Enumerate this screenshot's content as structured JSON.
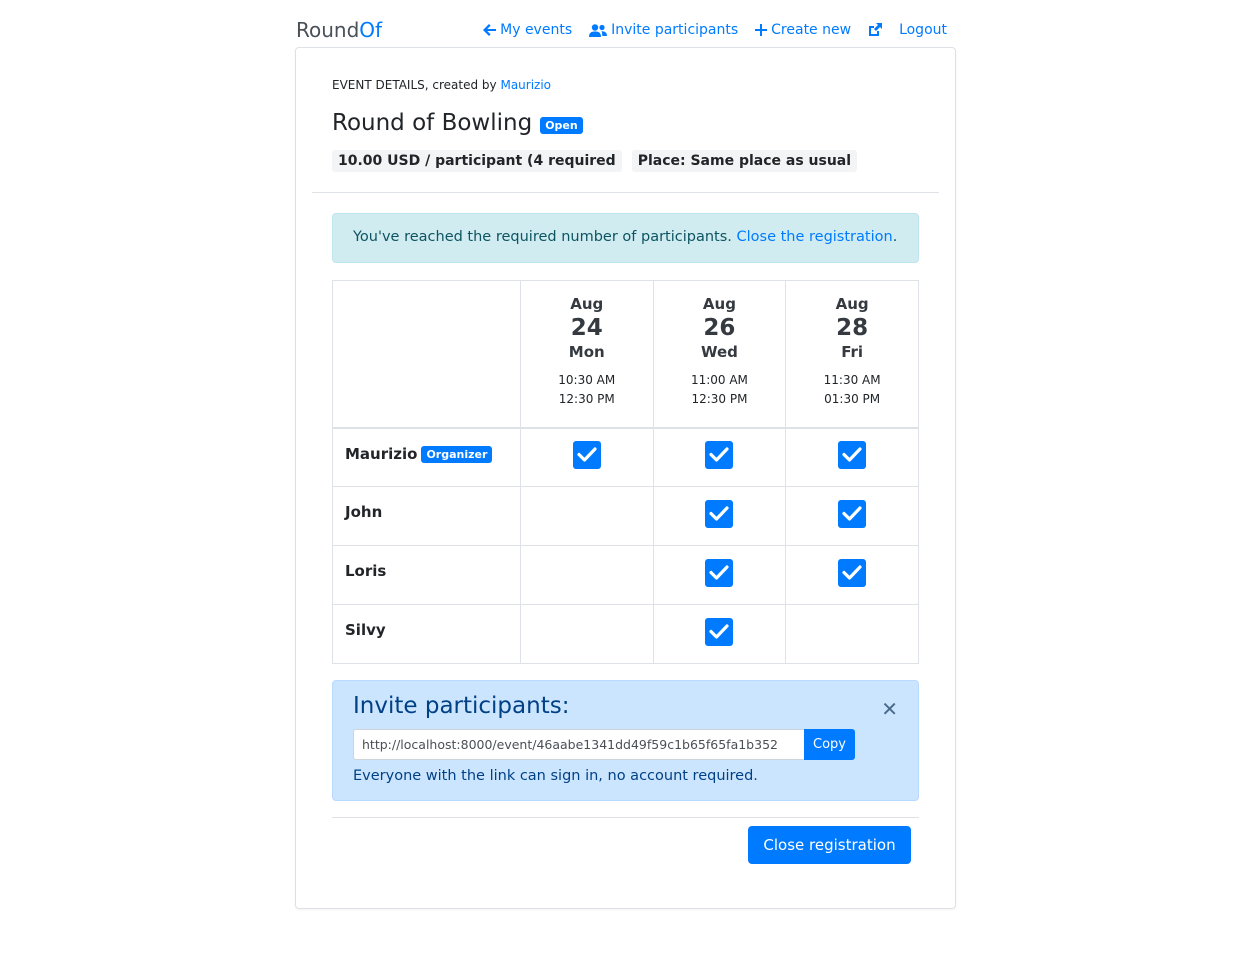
{
  "header": {
    "logo_part1": "Round",
    "logo_part2": "Of",
    "nav": {
      "my_events": "My events",
      "invite": "Invite participants",
      "create": "Create new",
      "logout": "Logout"
    }
  },
  "event": {
    "created_prefix": "EVENT DETAILS, created by",
    "creator": "Maurizio",
    "title": "Round of Bowling",
    "status": "Open",
    "price": "10.00 USD / participant (4 required",
    "place": "Place: Same place as usual"
  },
  "alert": {
    "text": "You've reached the required number of participants.",
    "link": "Close the registration",
    "period": "."
  },
  "dates": [
    {
      "month": "Aug",
      "day": "24",
      "weekday": "Mon",
      "start": "10:30 AM",
      "end": "12:30 PM"
    },
    {
      "month": "Aug",
      "day": "26",
      "weekday": "Wed",
      "start": "11:00 AM",
      "end": "12:30 PM"
    },
    {
      "month": "Aug",
      "day": "28",
      "weekday": "Fri",
      "start": "11:30 AM",
      "end": "01:30 PM"
    }
  ],
  "participants": [
    {
      "name": "Maurizio",
      "badge": "Organizer",
      "avail": [
        true,
        true,
        true
      ]
    },
    {
      "name": "John",
      "badge": "",
      "avail": [
        false,
        true,
        true
      ]
    },
    {
      "name": "Loris",
      "badge": "",
      "avail": [
        false,
        true,
        true
      ]
    },
    {
      "name": "Silvy",
      "badge": "",
      "avail": [
        false,
        true,
        false
      ]
    }
  ],
  "invite": {
    "title": "Invite participants:",
    "link": "http://localhost:8000/event/46aabe1341dd49f59c1b65f65fa1b352",
    "copy_label": "Copy",
    "note": "Everyone with the link can sign in, no account required."
  },
  "footer": {
    "close_button": "Close registration"
  },
  "colors": {
    "primary": "#007bff",
    "info_bg": "#d1ecf1",
    "invite_bg": "#cce5ff"
  }
}
